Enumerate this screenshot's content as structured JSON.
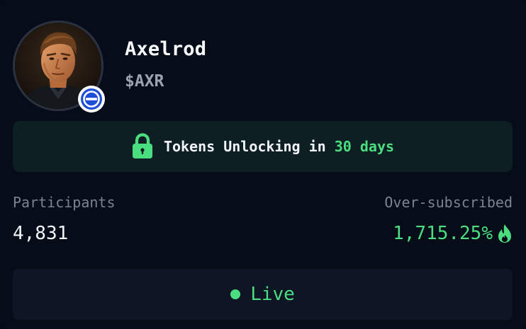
{
  "token": {
    "name": "Axelrod",
    "ticker": "$AXR",
    "avatar_icon": "portrait-avatar",
    "chain_badge_icon": "chain-logo-icon"
  },
  "unlock": {
    "icon": "lock-icon",
    "text": "Tokens Unlocking in ",
    "days": "30 days"
  },
  "stats": {
    "participants_label": "Participants",
    "participants_value": "4,831",
    "oversub_label": "Over-subscribed",
    "oversub_value": "1,715.25%",
    "oversub_icon": "flame-icon"
  },
  "status": {
    "label": "Live",
    "indicator_icon": "live-dot-icon"
  },
  "colors": {
    "background": "#060c18",
    "accent_green": "#4ade80",
    "muted_text": "#7b8492",
    "banner_bg": "#0d1f22",
    "button_bg": "#0e1525",
    "badge_blue": "#1d4ed8"
  }
}
